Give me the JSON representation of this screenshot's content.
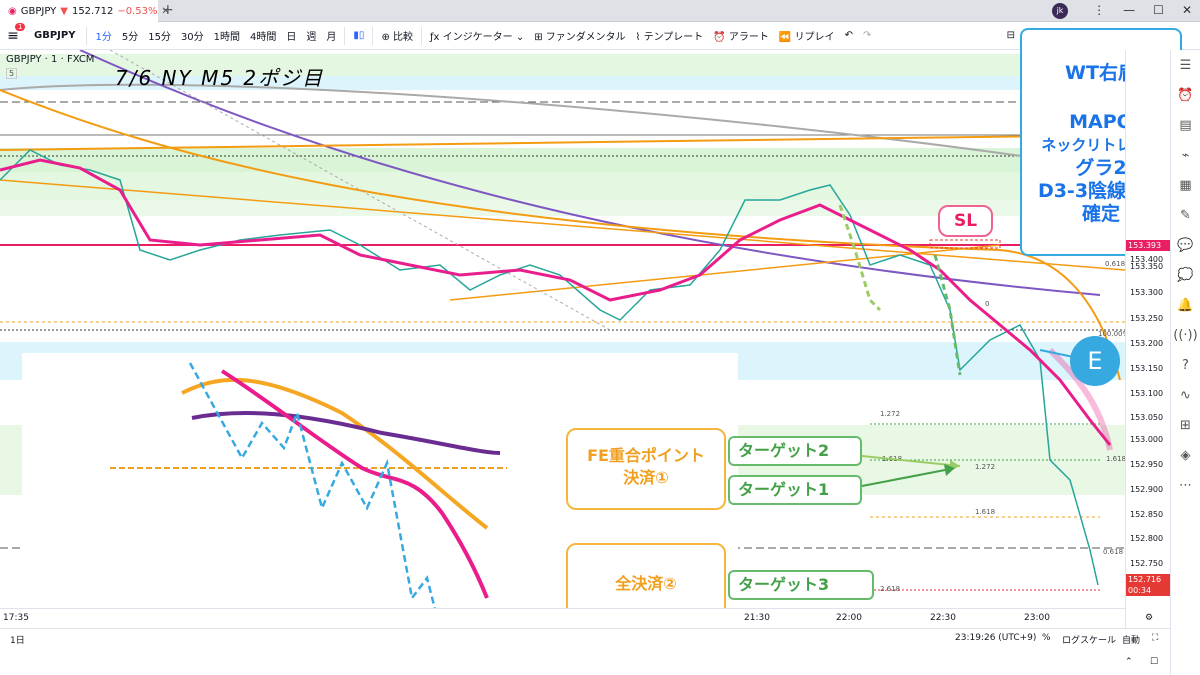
{
  "browser": {
    "tab_title": "GBPJPY",
    "tab_price": "152.712",
    "tab_change": "−0.53%",
    "tab_short": "G"
  },
  "toolbar": {
    "symbol": "GBPJPY",
    "intervals": [
      "1分",
      "5分",
      "15分",
      "30分",
      "1時間",
      "4時間",
      "日",
      "週",
      "月"
    ],
    "active_interval": "1分",
    "compare": "比較",
    "indicators": "インジケーター",
    "fundamentals": "ファンダメンタル",
    "templates": "テンプレート",
    "alert": "アラート",
    "replay": "リプレイ",
    "menu_badge": "1"
  },
  "chart": {
    "symbol_label": "GBPJPY · 1 · FXCM",
    "sub_label": "5",
    "title": "7/6  NY  M5  2ポジ目"
  },
  "price_axis": {
    "labels": [
      "153.400",
      "153.350",
      "153.300",
      "153.250",
      "153.200",
      "153.150",
      "153.100",
      "153.050",
      "153.000",
      "152.950",
      "152.900",
      "152.850",
      "152.800",
      "152.750"
    ],
    "current_price": "153.393",
    "last_price": "152.716",
    "last_time": "00:34"
  },
  "time_axis": {
    "labels": [
      "17:35",
      "21:30",
      "22:00",
      "22:30",
      "23:00"
    ]
  },
  "bottom": {
    "range": "1日",
    "clock": "23:19:26 (UTC+9)",
    "percent": "%",
    "log": "ログスケール",
    "auto": "自動"
  },
  "annotations": {
    "callout_lines": [
      "WT右肩",
      "",
      "MAPO",
      "ネックリトレース",
      "グラ2",
      "D3-3陰線実体",
      "確定"
    ],
    "sl": "SL",
    "entry": "E",
    "fe_point": [
      "FE重合ポイント",
      "決済①"
    ],
    "full_exit": "全決済②",
    "target1": "ターゲット1",
    "target2": "ターゲット2",
    "target3": "ターゲット3"
  },
  "fib_labels": [
    "0.618",
    "1.272",
    "1.618",
    "1.618",
    "1.272",
    "1.618",
    "0.618",
    "2.618",
    "0",
    "100.00%"
  ]
}
